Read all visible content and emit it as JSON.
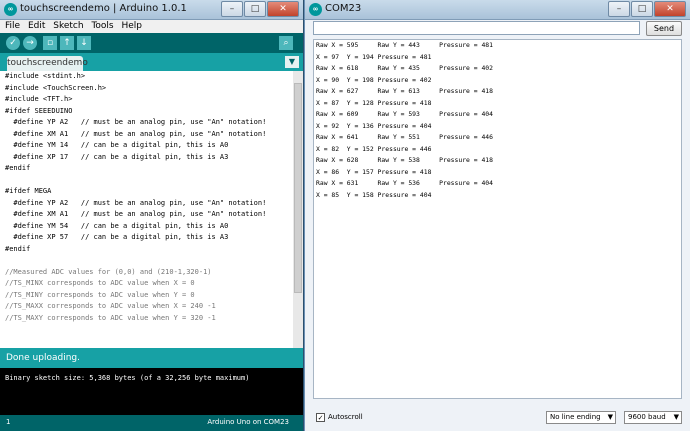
{
  "ide": {
    "title": "touchscreendemo | Arduino 1.0.1",
    "menu": [
      "File",
      "Edit",
      "Sketch",
      "Tools",
      "Help"
    ],
    "tab": "touchscreendemo",
    "code": [
      {
        "t": "#include <stdint.h>",
        "c": false
      },
      {
        "t": "#include <TouchScreen.h>",
        "c": false
      },
      {
        "t": "#include <TFT.h>",
        "c": false
      },
      {
        "t": "#ifdef SEEEDUINO",
        "c": false
      },
      {
        "t": "  #define YP A2   // must be an analog pin, use \"An\" notation!",
        "c": false
      },
      {
        "t": "  #define XM A1   // must be an analog pin, use \"An\" notation!",
        "c": false
      },
      {
        "t": "  #define YM 14   // can be a digital pin, this is A0",
        "c": false
      },
      {
        "t": "  #define XP 17   // can be a digital pin, this is A3",
        "c": false
      },
      {
        "t": "#endif",
        "c": false
      },
      {
        "t": "",
        "c": false
      },
      {
        "t": "#ifdef MEGA",
        "c": false
      },
      {
        "t": "  #define YP A2   // must be an analog pin, use \"An\" notation!",
        "c": false
      },
      {
        "t": "  #define XM A1   // must be an analog pin, use \"An\" notation!",
        "c": false
      },
      {
        "t": "  #define YM 54   // can be a digital pin, this is A0",
        "c": false
      },
      {
        "t": "  #define XP 57   // can be a digital pin, this is A3",
        "c": false
      },
      {
        "t": "#endif",
        "c": false
      },
      {
        "t": "",
        "c": false
      },
      {
        "t": "//Measured ADC values for (0,0) and (210-1,320-1)",
        "c": true
      },
      {
        "t": "//TS_MINX corresponds to ADC value when X = 0",
        "c": true
      },
      {
        "t": "//TS_MINY corresponds to ADC value when Y = 0",
        "c": true
      },
      {
        "t": "//TS_MAXX corresponds to ADC value when X = 240 -1",
        "c": true
      },
      {
        "t": "//TS_MAXY corresponds to ADC value when Y = 320 -1",
        "c": true
      }
    ],
    "status": "Done uploading.",
    "console": "Binary sketch size: 5,368 bytes (of a 32,256 byte maximum)",
    "line_number": "1",
    "board": "Arduino Uno on COM23"
  },
  "serial": {
    "title": "COM23",
    "input_value": "",
    "send_label": "Send",
    "output": [
      "Raw X = 595     Raw Y = 443     Pressure = 481",
      "X = 97  Y = 194 Pressure = 481",
      "Raw X = 618     Raw Y = 435     Pressure = 402",
      "X = 90  Y = 198 Pressure = 402",
      "Raw X = 627     Raw Y = 613     Pressure = 418",
      "X = 87  Y = 128 Pressure = 418",
      "Raw X = 609     Raw Y = 593     Pressure = 404",
      "X = 92  Y = 136 Pressure = 404",
      "Raw X = 641     Raw Y = 551     Pressure = 446",
      "X = 82  Y = 152 Pressure = 446",
      "Raw X = 628     Raw Y = 538     Pressure = 418",
      "X = 86  Y = 157 Pressure = 418",
      "Raw X = 631     Raw Y = 536     Pressure = 404",
      "X = 85  Y = 158 Pressure = 404"
    ],
    "autoscroll_label": "Autoscroll",
    "autoscroll_checked": true,
    "line_ending": "No line ending",
    "baud": "9600 baud"
  }
}
